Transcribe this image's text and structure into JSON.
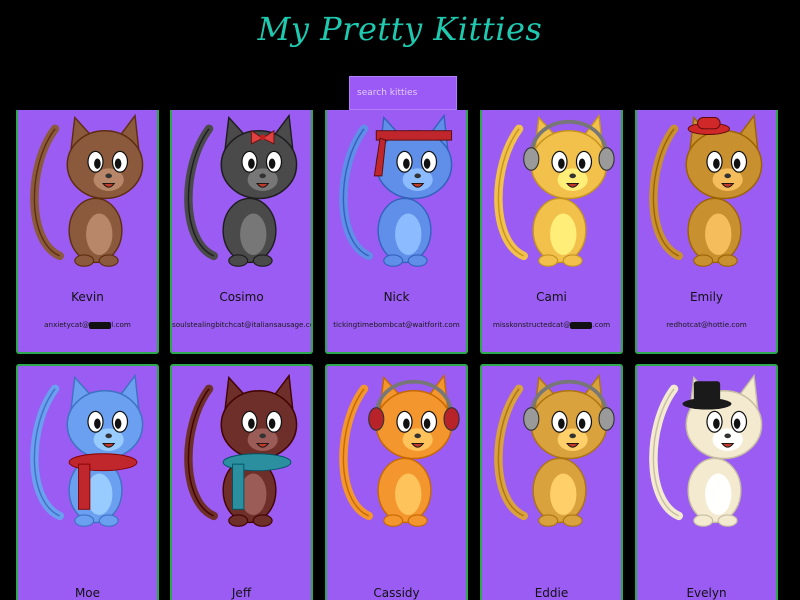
{
  "header": {
    "title": "My Pretty Kitties"
  },
  "search": {
    "placeholder": "search kitties"
  },
  "colors": {
    "background": "#000000",
    "title": "#1fc9b0",
    "card": "#9a5cf2",
    "card_border": "#2ea84e"
  },
  "kitties": [
    {
      "name": "Kevin",
      "email_prefix": "anxietycat@",
      "email_suffix": "l.com",
      "email_redacted": true,
      "fur": "#8b5a3c",
      "accessory": "none"
    },
    {
      "name": "Cosimo",
      "email": "soulstealingbitchcat@italiansausage.com",
      "fur": "#4a4a4a",
      "accessory": "red-bow"
    },
    {
      "name": "Nick",
      "email": "tickingtimebombcat@waitforit.com",
      "fur": "#5f8fe8",
      "accessory": "red-bandana"
    },
    {
      "name": "Cami",
      "email_prefix": "misskonstructedcat@",
      "email_suffix": ".com",
      "email_redacted": true,
      "fur": "#f2c14b",
      "accessory": "headphones-gray"
    },
    {
      "name": "Emily",
      "email": "redhotcat@hottie.com",
      "fur": "#c9902f",
      "accessory": "red-hat"
    },
    {
      "name": "Moe",
      "fur": "#6b9ff0",
      "accessory": "red-scarf"
    },
    {
      "name": "Jeff",
      "fur": "#6e2f2a",
      "accessory": "teal-scarf"
    },
    {
      "name": "Cassidy",
      "fur": "#f3962e",
      "accessory": "headphones-red"
    },
    {
      "name": "Eddie",
      "fur": "#d9a23d",
      "accessory": "headphones-gray"
    },
    {
      "name": "Evelyn",
      "fur": "#f3ead0",
      "accessory": "top-hat"
    }
  ]
}
